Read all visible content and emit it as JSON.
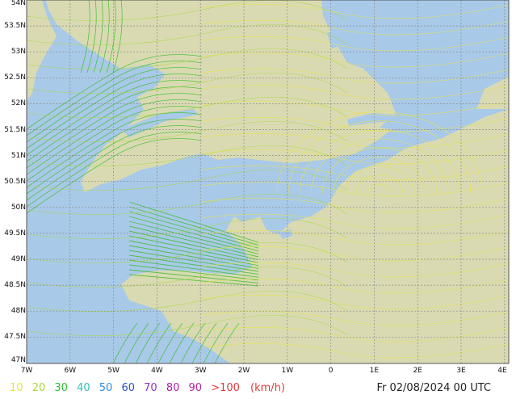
{
  "map": {
    "lat_labels": [
      "54N",
      "53.5N",
      "53N",
      "52.5N",
      "52N",
      "51.5N",
      "51N",
      "50.5N",
      "50N",
      "49.5N",
      "49N",
      "48.5N",
      "48N",
      "47.5N",
      "47N"
    ],
    "lon_labels": [
      "7W",
      "6W",
      "5W",
      "4W",
      "3W",
      "2W",
      "1W",
      "0",
      "1E",
      "2E",
      "3E",
      "4E"
    ],
    "colors": {
      "sea": "#a9c9e8",
      "land": "#d9dab2",
      "grid": "#8b8b8b",
      "stream_low": "#e6e442",
      "stream_mid": "#a8d83a",
      "stream_high": "#3cbf2e"
    }
  },
  "legend": {
    "items": [
      {
        "label": "10",
        "color": "#e6e442"
      },
      {
        "label": "20",
        "color": "#a8d83a"
      },
      {
        "label": "30",
        "color": "#2cbf2e"
      },
      {
        "label": "40",
        "color": "#34c0b8"
      },
      {
        "label": "50",
        "color": "#2e8fe0"
      },
      {
        "label": "60",
        "color": "#2a4fd0"
      },
      {
        "label": "70",
        "color": "#8a34c8"
      },
      {
        "label": "80",
        "color": "#b020b0"
      },
      {
        "label": "90",
        "color": "#c0209a"
      },
      {
        "label": ">100",
        "color": "#e03a3a"
      }
    ],
    "unit": "(km/h)",
    "unit_color": "#e03a3a"
  },
  "timestamp": "Fr 02/08/2024 00 UTC"
}
